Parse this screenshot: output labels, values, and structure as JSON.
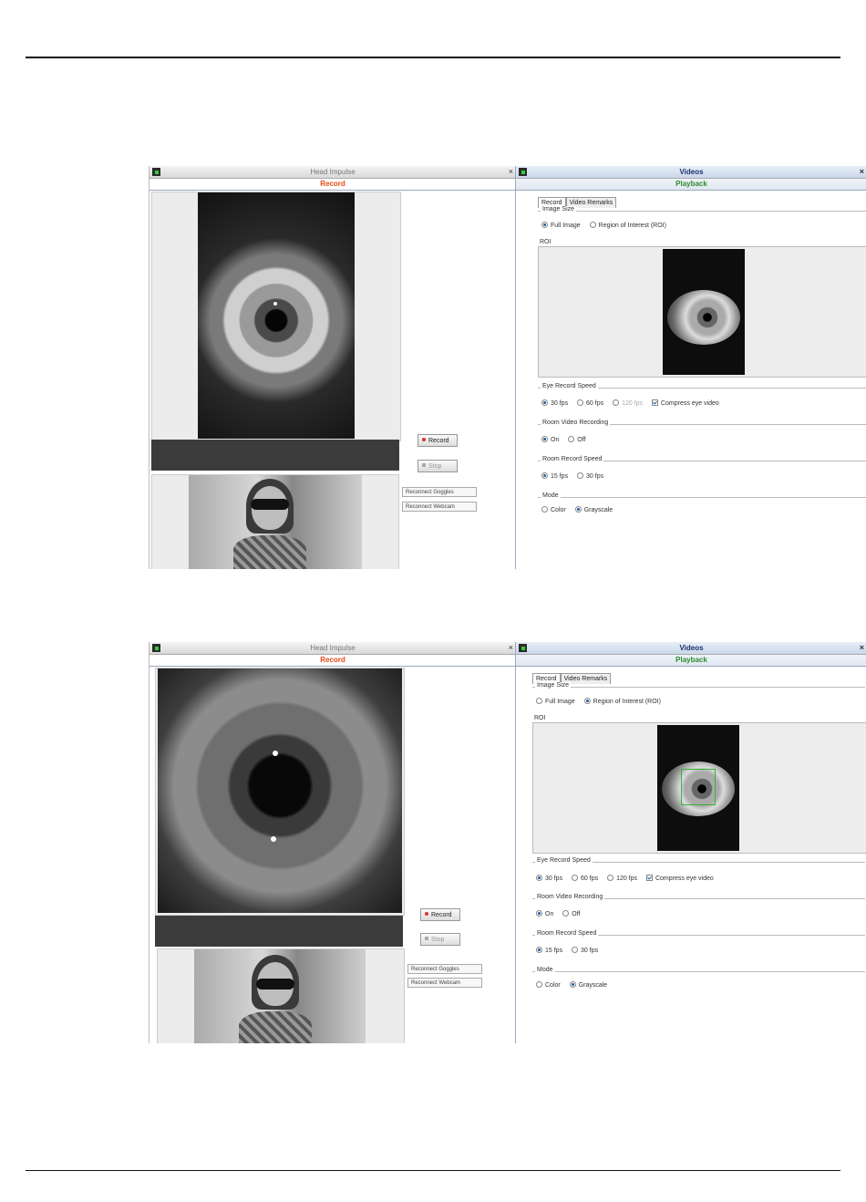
{
  "screenshots": [
    {
      "left_panel": {
        "title": "Head Impulse",
        "close": "×",
        "subtitle": "Record"
      },
      "right_panel": {
        "title": "Videos",
        "close": "×",
        "subtitle": "Playback"
      },
      "buttons": {
        "record": "Record",
        "stop": "Stop",
        "reconnect_goggles": "Reconnect Goggles",
        "reconnect_webcam": "Reconnect Webcam"
      },
      "tabs": [
        "Record",
        "Video Remarks"
      ],
      "image_size": {
        "legend": "Image Size",
        "options": [
          "Full Image",
          "Region of Interest (ROI)"
        ],
        "selected": "Full Image"
      },
      "roi_label": "ROI",
      "eye_record_speed": {
        "legend": "Eye Record Speed",
        "options": [
          "30 fps",
          "60 fps",
          "120 fps"
        ],
        "selected": "30 fps",
        "disabled": "120 fps",
        "compress_label": "Compress eye video",
        "compress_checked": true
      },
      "room_video_recording": {
        "legend": "Room Video Recording",
        "options": [
          "On",
          "Off"
        ],
        "selected": "On"
      },
      "room_record_speed": {
        "legend": "Room Record Speed",
        "options": [
          "15 fps",
          "30 fps"
        ],
        "selected": "15 fps"
      },
      "mode": {
        "legend": "Mode",
        "options": [
          "Color",
          "Grayscale"
        ],
        "selected": "Grayscale"
      }
    },
    {
      "left_panel": {
        "title": "Head Impulse",
        "close": "×",
        "subtitle": "Record"
      },
      "right_panel": {
        "title": "Videos",
        "close": "×",
        "subtitle": "Playback"
      },
      "buttons": {
        "record": "Record",
        "stop": "Stop",
        "reconnect_goggles": "Reconnect Goggles",
        "reconnect_webcam": "Reconnect Webcam"
      },
      "tabs": [
        "Record",
        "Video Remarks"
      ],
      "image_size": {
        "legend": "Image Size",
        "options": [
          "Full Image",
          "Region of Interest (ROI)"
        ],
        "selected": "Region of Interest (ROI)"
      },
      "roi_label": "ROI",
      "eye_record_speed": {
        "legend": "Eye Record Speed",
        "options": [
          "30 fps",
          "60 fps",
          "120 fps"
        ],
        "selected": "30 fps",
        "disabled": "",
        "compress_label": "Compress eye video",
        "compress_checked": true
      },
      "room_video_recording": {
        "legend": "Room Video Recording",
        "options": [
          "On",
          "Off"
        ],
        "selected": "On"
      },
      "room_record_speed": {
        "legend": "Room Record Speed",
        "options": [
          "15 fps",
          "30 fps"
        ],
        "selected": "15 fps"
      },
      "mode": {
        "legend": "Mode",
        "options": [
          "Color",
          "Grayscale"
        ],
        "selected": "Grayscale"
      }
    }
  ]
}
